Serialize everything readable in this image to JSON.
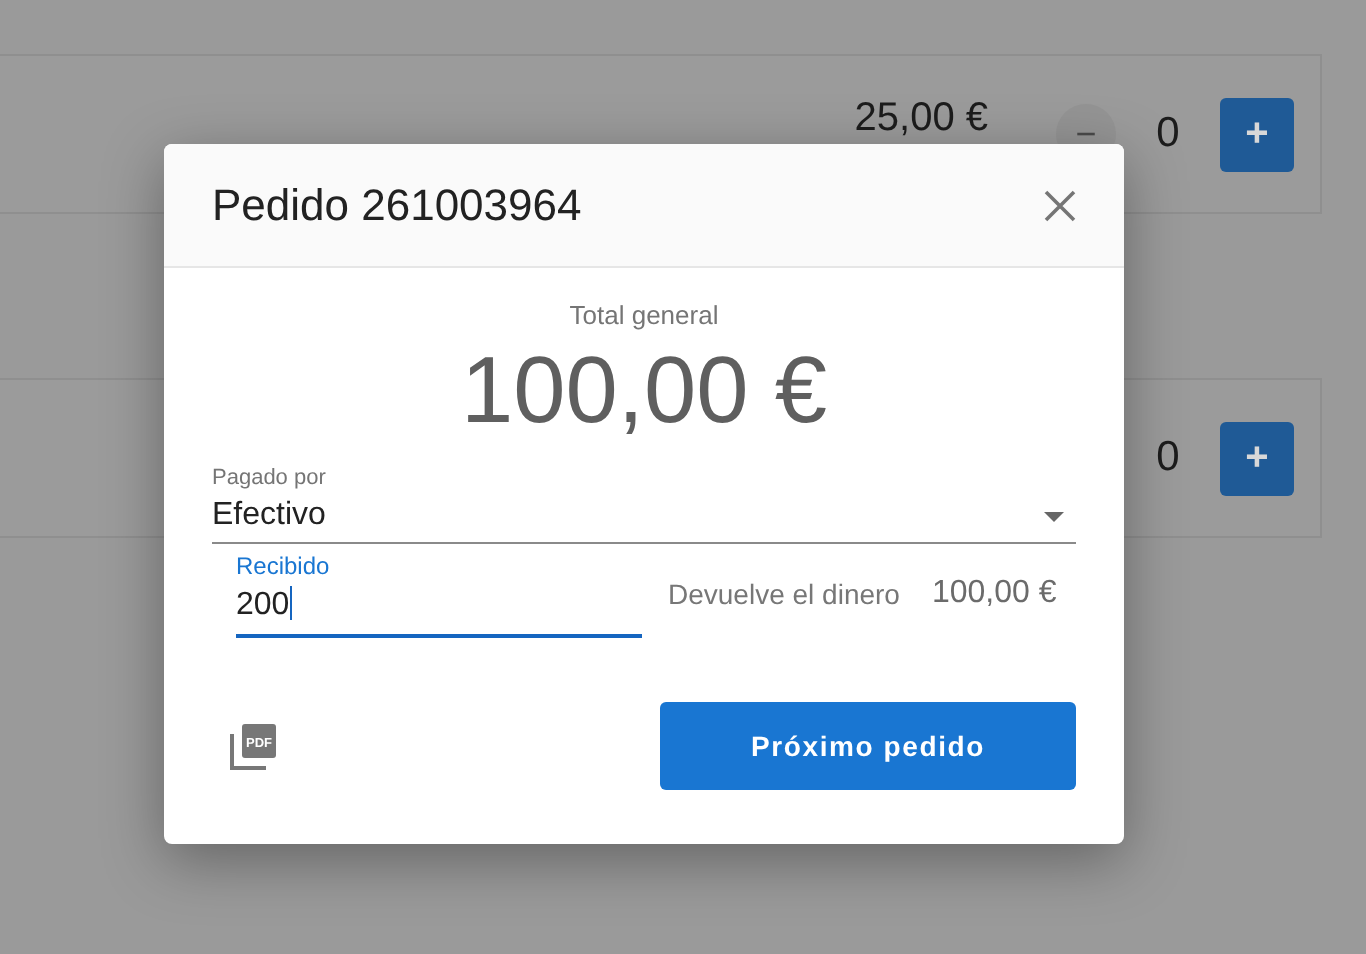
{
  "background": {
    "products": [
      {
        "price": "25,00 €",
        "minus": "−",
        "quantity": "0",
        "plus": "+"
      },
      {
        "quantity": "0",
        "plus": "+"
      }
    ]
  },
  "dialog": {
    "title": "Pedido 261003964",
    "total_label": "Total general",
    "total": "100,00 €",
    "payment": {
      "label": "Pagado por",
      "value": "Efectivo"
    },
    "received": {
      "label": "Recibido",
      "value": "200",
      "focused": true
    },
    "change": {
      "label": "Devuelve el dinero",
      "amount": "100,00 €"
    },
    "pdf_icon_text": "PDF",
    "primary_button": "Próximo pedido"
  }
}
